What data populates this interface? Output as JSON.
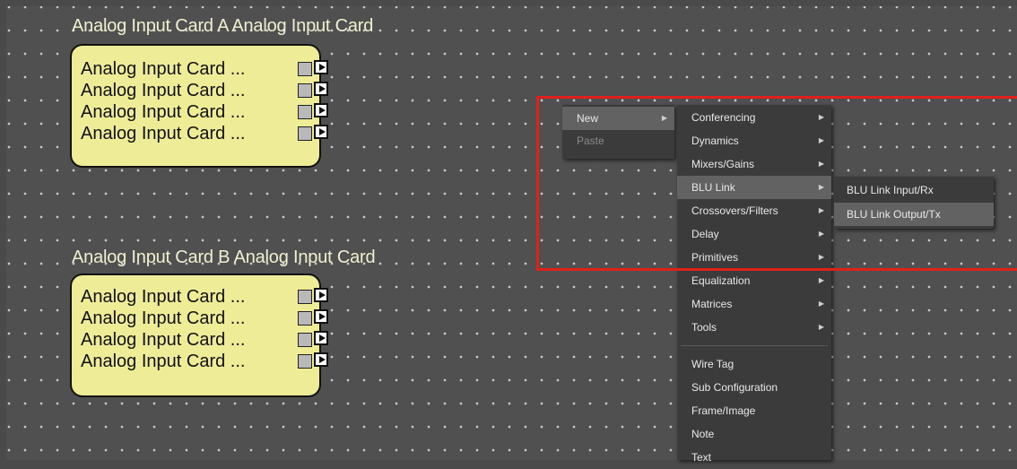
{
  "canvas": {
    "block_a": {
      "title": "Analog Input Card A  Analog Input Card",
      "rows": [
        "Analog Input Card ...",
        "Analog Input Card ...",
        "Analog Input Card ...",
        "Analog Input Card ..."
      ]
    },
    "block_b": {
      "title": "Analog Input Card B  Analog Input Card",
      "rows": [
        "Analog Input Card ...",
        "Analog Input Card ...",
        "Analog Input Card ...",
        "Analog Input Card ..."
      ]
    }
  },
  "context_menu": {
    "new_label": "New",
    "paste_label": "Paste"
  },
  "new_submenu": {
    "items": [
      "Conferencing",
      "Dynamics",
      "Mixers/Gains",
      "BLU Link",
      "Crossovers/Filters",
      "Delay",
      "Primitives",
      "Equalization",
      "Matrices",
      "Tools",
      "Wire Tag",
      "Sub Configuration",
      "Frame/Image",
      "Note",
      "Text"
    ]
  },
  "blu_link_submenu": {
    "items": [
      "BLU Link Input/Rx",
      "BLU Link Output/Tx"
    ]
  },
  "colors": {
    "block_fill": "#eeec96",
    "highlight_box": "#e0201c",
    "menu_bg": "#3b3b3b"
  }
}
